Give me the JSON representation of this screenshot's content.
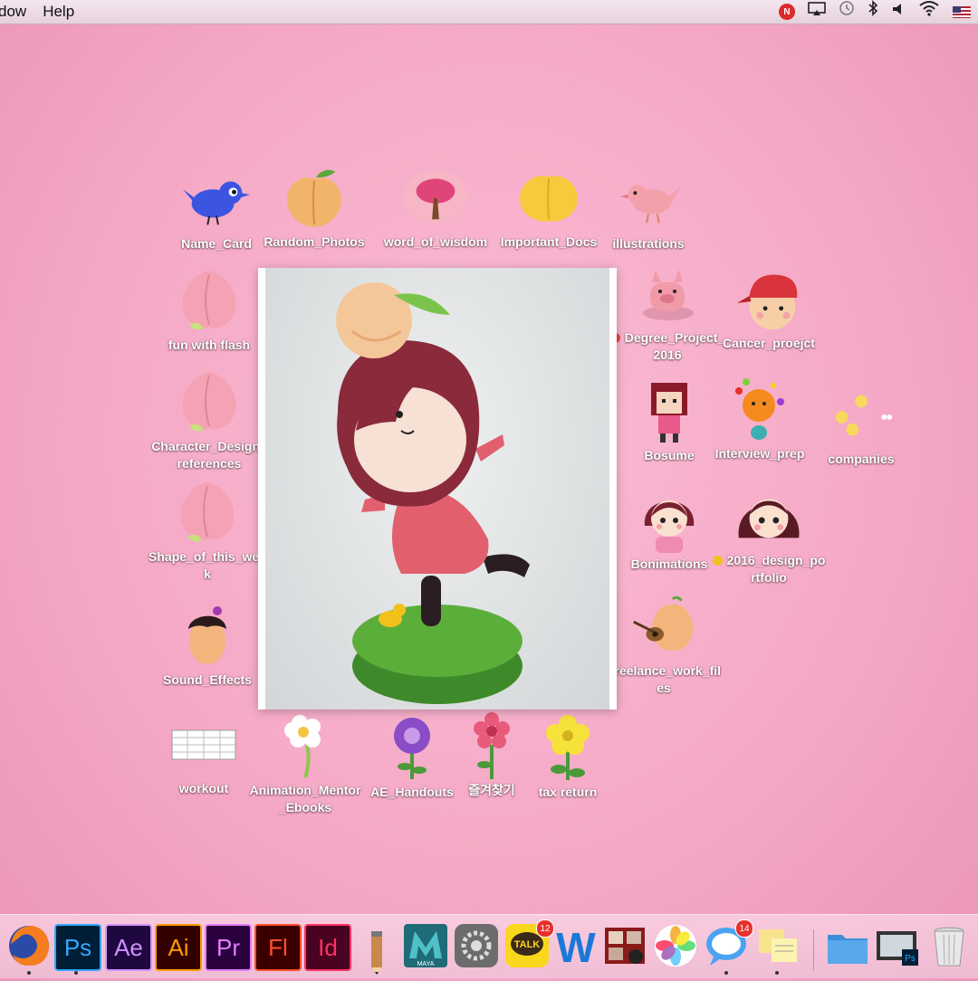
{
  "menubar": {
    "menus": [
      "dow",
      "Help"
    ],
    "status_icons": [
      "notification-icon",
      "airplay-icon",
      "time-machine-icon",
      "bluetooth-icon",
      "volume-icon",
      "wifi-icon",
      "flag-icon"
    ],
    "notification_badge": "N"
  },
  "desktop": {
    "icons": [
      {
        "label": "Name_Card",
        "art": "blue-bird"
      },
      {
        "label": "Random_Photos",
        "art": "peach"
      },
      {
        "label": "word_of_wisdom",
        "art": "tree"
      },
      {
        "label": "Important_Docs",
        "art": "yellow-peach"
      },
      {
        "label": "illustrations",
        "art": "pink-bird"
      },
      {
        "label": "fun with flash",
        "art": "peach-pink"
      },
      {
        "label": "Character_Design_references",
        "art": "peach-pink"
      },
      {
        "label": "Shape_of_this_week",
        "art": "peach-pink"
      },
      {
        "label": "Sound_Effects",
        "art": "peach-girl"
      },
      {
        "label": "workout",
        "art": "spreadsheet"
      },
      {
        "label": "Animation_Mentor_Ebooks",
        "art": "white-flower"
      },
      {
        "label": "AE_Handouts",
        "art": "purple-flower"
      },
      {
        "label": "즐겨찾기",
        "art": "red-flower"
      },
      {
        "label": "tax return",
        "art": "yellow-flower"
      },
      {
        "label": "Degree_Project_2016",
        "art": "pig",
        "tag": "#e84545"
      },
      {
        "label": "Cancer_proejct",
        "art": "boy-cap"
      },
      {
        "label": "Bosume",
        "art": "pixel-girl"
      },
      {
        "label": "Interview_prep",
        "art": "orange-char"
      },
      {
        "label": "companies",
        "art": "chicks"
      },
      {
        "label": "Bonimations",
        "art": "girl-face"
      },
      {
        "label": "2016_design_portfolio",
        "art": "girl-face2",
        "tag": "#f2c21b"
      },
      {
        "label": "Freelance_work_files",
        "art": "peach-guitar"
      }
    ]
  },
  "photo": {
    "subject": "clay figurine holding a peach"
  },
  "dock": {
    "apps": [
      {
        "name": "Firefox"
      },
      {
        "name": "Ps",
        "color": "#31a8ff",
        "bg": "#001e36"
      },
      {
        "name": "Ae",
        "color": "#d291ff",
        "bg": "#1f0740"
      },
      {
        "name": "Ai",
        "color": "#ff9a00",
        "bg": "#330000"
      },
      {
        "name": "Pr",
        "color": "#e77cff",
        "bg": "#2a003f"
      },
      {
        "name": "Fl",
        "color": "#ff4f2b",
        "bg": "#3a0000"
      },
      {
        "name": "Id",
        "color": "#ff3366",
        "bg": "#49021f"
      },
      {
        "name": "Pencil"
      },
      {
        "name": "MAYA"
      },
      {
        "name": "System Preferences"
      },
      {
        "name": "TALK",
        "badge": "12"
      },
      {
        "name": "W"
      },
      {
        "name": "Photo Booth"
      },
      {
        "name": "Photos"
      },
      {
        "name": "Messages",
        "badge": "14"
      },
      {
        "name": "Stickies"
      },
      {
        "name": "Folder"
      },
      {
        "name": "Photoshop Doc"
      },
      {
        "name": "Trash"
      }
    ]
  }
}
